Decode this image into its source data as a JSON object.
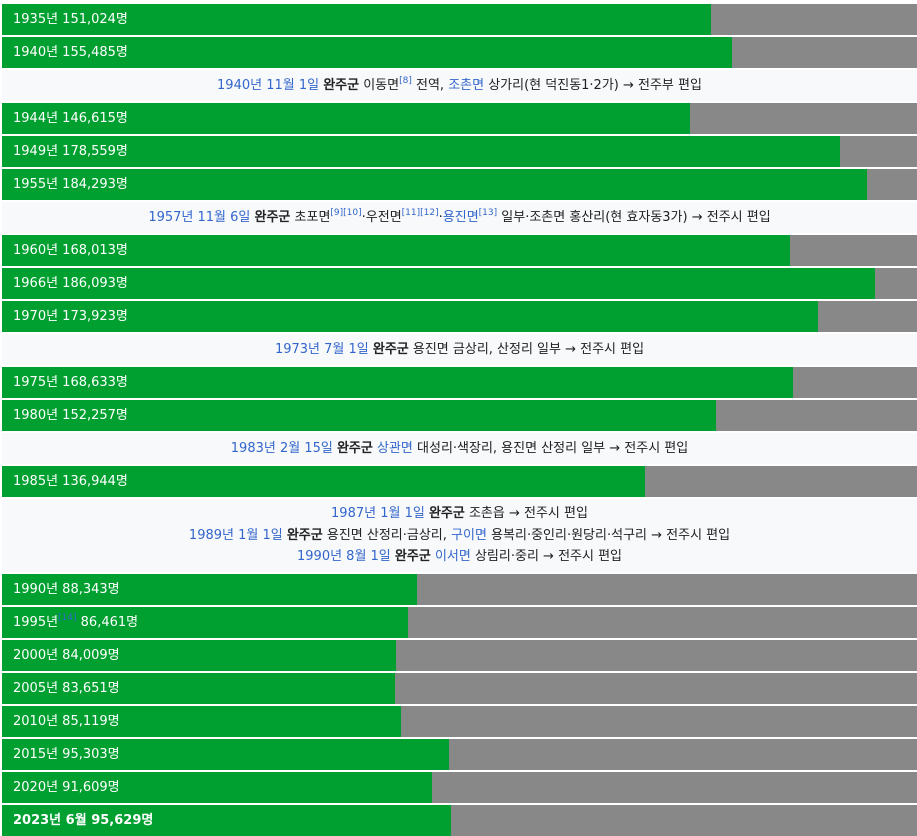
{
  "chart_data": {
    "type": "bar",
    "orientation": "horizontal",
    "max_value": 195000,
    "colors": {
      "bar": "#00a030",
      "track": "#888888",
      "note_bg": "#f8f9fa",
      "link": "#3366cc"
    },
    "rows": [
      {
        "kind": "bar",
        "label": "1935년 151,024명",
        "value": 151024
      },
      {
        "kind": "bar",
        "label": "1940년 155,485명",
        "value": 155485
      },
      {
        "kind": "note",
        "lines": [
          [
            {
              "t": "1940년 11월 1일",
              "s": "link"
            },
            {
              "t": " "
            },
            {
              "t": "완주군",
              "s": "bold"
            },
            {
              "t": " 이동면"
            },
            {
              "t": "[8]",
              "s": "sup"
            },
            {
              "t": " 전역, "
            },
            {
              "t": "조촌면",
              "s": "link"
            },
            {
              "t": " 상가리(현 덕진동1·2가) → 전주부 편입"
            }
          ]
        ]
      },
      {
        "kind": "bar",
        "label": "1944년 146,615명",
        "value": 146615
      },
      {
        "kind": "bar",
        "label": "1949년 178,559명",
        "value": 178559
      },
      {
        "kind": "bar",
        "label": "1955년 184,293명",
        "value": 184293
      },
      {
        "kind": "note",
        "lines": [
          [
            {
              "t": "1957년 11월 6일",
              "s": "link"
            },
            {
              "t": " "
            },
            {
              "t": "완주군",
              "s": "bold"
            },
            {
              "t": " 초포면"
            },
            {
              "t": "[9]",
              "s": "sup"
            },
            {
              "t": "[10]",
              "s": "sup"
            },
            {
              "t": "·우전면"
            },
            {
              "t": "[11]",
              "s": "sup"
            },
            {
              "t": "[12]",
              "s": "sup"
            },
            {
              "t": "·"
            },
            {
              "t": "용진면",
              "s": "link"
            },
            {
              "t": "[13]",
              "s": "sup"
            },
            {
              "t": " 일부·조촌면 홍산리(현 효자동3가) → 전주시 편입"
            }
          ]
        ]
      },
      {
        "kind": "bar",
        "label": "1960년 168,013명",
        "value": 168013
      },
      {
        "kind": "bar",
        "label": "1966년 186,093명",
        "value": 186093
      },
      {
        "kind": "bar",
        "label": "1970년 173,923명",
        "value": 173923
      },
      {
        "kind": "note",
        "lines": [
          [
            {
              "t": "1973년 7월 1일",
              "s": "link"
            },
            {
              "t": " "
            },
            {
              "t": "완주군",
              "s": "bold"
            },
            {
              "t": " 용진면 금상리, 산정리 일부 → 전주시 편입"
            }
          ]
        ]
      },
      {
        "kind": "bar",
        "label": "1975년 168,633명",
        "value": 168633
      },
      {
        "kind": "bar",
        "label": "1980년 152,257명",
        "value": 152257
      },
      {
        "kind": "note",
        "lines": [
          [
            {
              "t": "1983년 2월 15일",
              "s": "link"
            },
            {
              "t": " "
            },
            {
              "t": "완주군",
              "s": "bold"
            },
            {
              "t": " "
            },
            {
              "t": "상관면",
              "s": "link"
            },
            {
              "t": " 대성리·색장리, 용진면 산정리 일부 → 전주시 편입"
            }
          ]
        ]
      },
      {
        "kind": "bar",
        "label": "1985년 136,944명",
        "value": 136944
      },
      {
        "kind": "note",
        "lines": [
          [
            {
              "t": "1987년 1월 1일",
              "s": "link"
            },
            {
              "t": " "
            },
            {
              "t": "완주군",
              "s": "bold"
            },
            {
              "t": " 조촌읍 → 전주시 편입"
            }
          ],
          [
            {
              "t": "1989년 1월 1일",
              "s": "link"
            },
            {
              "t": " "
            },
            {
              "t": "완주군",
              "s": "bold"
            },
            {
              "t": " 용진면 산정리·금상리, "
            },
            {
              "t": "구이면",
              "s": "link"
            },
            {
              "t": " 용복리·중인리·원당리·석구리 → 전주시 편입"
            }
          ],
          [
            {
              "t": "1990년 8월 1일",
              "s": "link"
            },
            {
              "t": " "
            },
            {
              "t": "완주군",
              "s": "bold"
            },
            {
              "t": " "
            },
            {
              "t": "이서면",
              "s": "link"
            },
            {
              "t": " 상림리·중리 → 전주시 편입"
            }
          ]
        ]
      },
      {
        "kind": "bar",
        "label": "1990년 88,343명",
        "value": 88343
      },
      {
        "kind": "bar",
        "label": "1995년",
        "label_sup": "[14]",
        "label_tail": " 86,461명",
        "value": 86461
      },
      {
        "kind": "bar",
        "label": "2000년 84,009명",
        "value": 84009
      },
      {
        "kind": "bar",
        "label": "2005년 83,651명",
        "value": 83651
      },
      {
        "kind": "bar",
        "label": "2010년 85,119명",
        "value": 85119
      },
      {
        "kind": "bar",
        "label": "2015년 95,303명",
        "value": 95303
      },
      {
        "kind": "bar",
        "label": "2020년 91,609명",
        "value": 91609
      },
      {
        "kind": "bar",
        "label": "2023년 6월 95,629명",
        "value": 95629,
        "bold": true
      }
    ]
  }
}
